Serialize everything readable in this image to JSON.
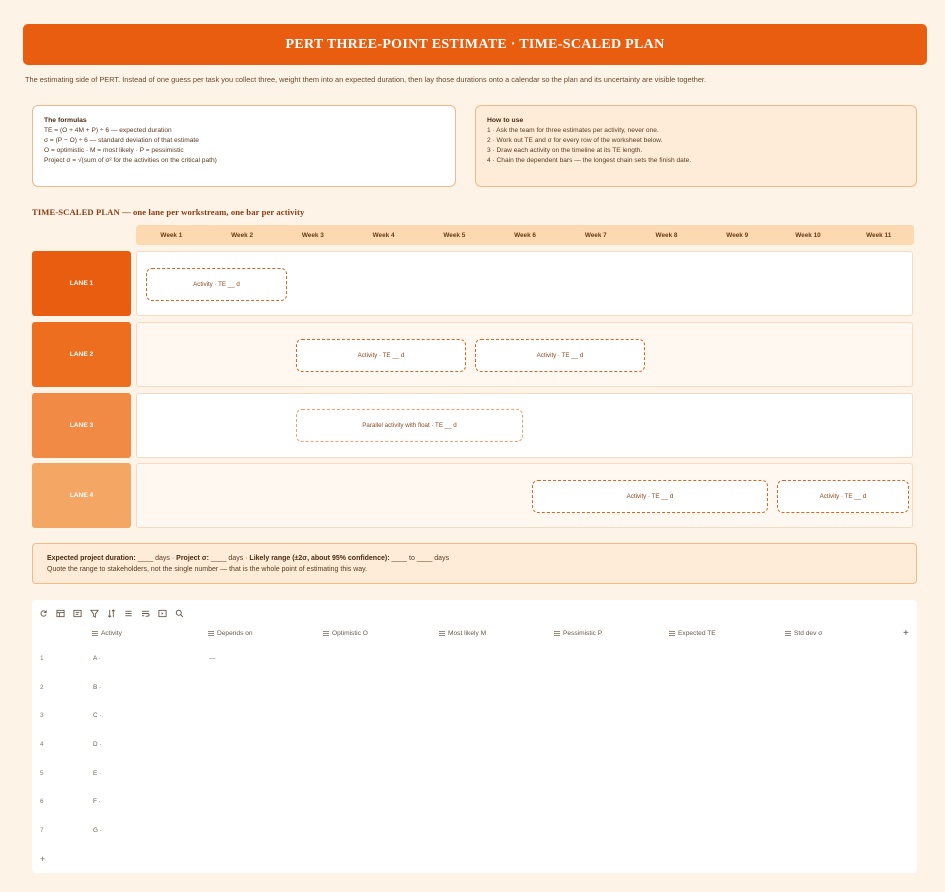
{
  "header": {
    "title": "PERT THREE-POINT ESTIMATE · TIME-SCALED PLAN",
    "intro": "The estimating side of PERT. Instead of one guess per task you collect three, weight them into an expected duration, then lay those durations onto a calendar so the plan and its uncertainty are visible together."
  },
  "formulas": {
    "title": "The formulas",
    "lines": [
      "TE = (O + 4M + P) ÷ 6 — expected duration",
      "σ = (P − O) ÷ 6 — standard deviation of that estimate",
      "O = optimistic · M = most likely · P = pessimistic",
      "Project σ = √(sum of σ² for the activities on the critical path)"
    ]
  },
  "howto": {
    "title": "How to use",
    "lines": [
      "1 · Ask the team for three estimates per activity, never one.",
      "2 · Work out TE and σ for every row of the worksheet below.",
      "3 · Draw each activity on the timeline at its TE length.",
      "4 · Chain the dependent bars — the longest chain sets the finish date."
    ]
  },
  "plan": {
    "title": "TIME-SCALED PLAN — one lane per workstream, one bar per activity",
    "weeks": [
      "Week 1",
      "Week 2",
      "Week 3",
      "Week 4",
      "Week 5",
      "Week 6",
      "Week 7",
      "Week 8",
      "Week 9",
      "Week 10",
      "Week 11"
    ],
    "lanes": [
      {
        "label": "LANE 1",
        "color": "#e85d10",
        "bars": [
          {
            "text": "Activity · TE __ d"
          }
        ]
      },
      {
        "label": "LANE 2",
        "color": "#ec6e1e",
        "bars": [
          {
            "text": "Activity · TE __ d"
          },
          {
            "text": "Activity · TE __ d"
          }
        ]
      },
      {
        "label": "LANE 3",
        "color": "#f08a44",
        "bars": [
          {
            "text": "Parallel activity with float · TE __ d"
          }
        ]
      },
      {
        "label": "LANE 4",
        "color": "#f4a664",
        "bars": [
          {
            "text": "Activity · TE __ d"
          },
          {
            "text": "Activity · TE __ d"
          }
        ]
      }
    ]
  },
  "summary": {
    "label1": "Expected project duration:",
    "text1": " ____ days · ",
    "label2": "Project σ:",
    "text2": " ____ days · ",
    "label3": "Likely range (±2σ, about 95% confidence):",
    "text3": " ____ to ____ days",
    "note": "Quote the range to stakeholders, not the single number — that is the whole point of estimating this way."
  },
  "sheet": {
    "toolbar_icons": [
      "refresh-icon",
      "table-icon",
      "layout-icon",
      "filter-icon",
      "sort-icon",
      "list-icon",
      "wrap-icon",
      "freeze-icon",
      "search-icon"
    ],
    "columns": [
      "Activity",
      "Depends on",
      "Optimistic O",
      "Most likely M",
      "Pessimistic P",
      "Expected TE",
      "Std dev σ"
    ],
    "rows": [
      {
        "num": "1",
        "activity": "A ·",
        "depends": "—"
      },
      {
        "num": "2",
        "activity": "B ·",
        "depends": ""
      },
      {
        "num": "3",
        "activity": "C ·",
        "depends": ""
      },
      {
        "num": "4",
        "activity": "D ·",
        "depends": ""
      },
      {
        "num": "5",
        "activity": "E ·",
        "depends": ""
      },
      {
        "num": "6",
        "activity": "F ·",
        "depends": ""
      },
      {
        "num": "7",
        "activity": "G ·",
        "depends": ""
      }
    ],
    "add_row": "+",
    "add_column": "+"
  }
}
